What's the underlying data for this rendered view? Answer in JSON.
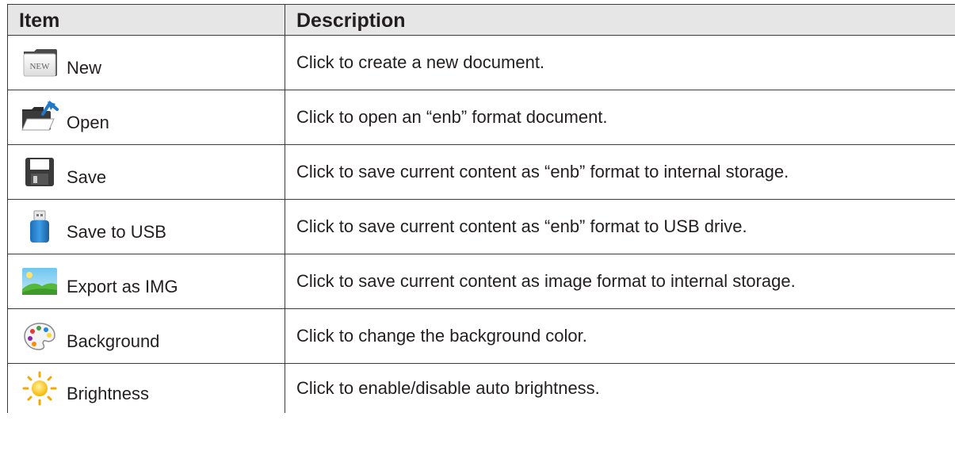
{
  "table": {
    "headers": {
      "item": "Item",
      "description": "Description"
    },
    "rows": [
      {
        "item": "New",
        "description": "Click to create a new document.",
        "icon": "new-document-icon",
        "icon_text": "NEW"
      },
      {
        "item": "Open",
        "description": "Click to open an “enb” format document.",
        "icon": "open-folder-icon"
      },
      {
        "item": "Save",
        "description": "Click to save current content as “enb” format to internal storage.",
        "icon": "floppy-disk-icon"
      },
      {
        "item": "Save to USB",
        "description": "Click to save current content as “enb” format to USB drive.",
        "icon": "usb-drive-icon"
      },
      {
        "item": "Export as IMG",
        "description": "Click to save current content as image format to internal storage.",
        "icon": "image-landscape-icon"
      },
      {
        "item": "Background",
        "description": "Click to change the background color.",
        "icon": "palette-icon"
      },
      {
        "item": "Brightness",
        "description": "Click to enable/disable auto brightness.",
        "icon": "sun-icon"
      }
    ]
  },
  "colors": {
    "header_bg": "#e6e6e6",
    "border": "#3a3a3a",
    "text": "#231f20"
  }
}
